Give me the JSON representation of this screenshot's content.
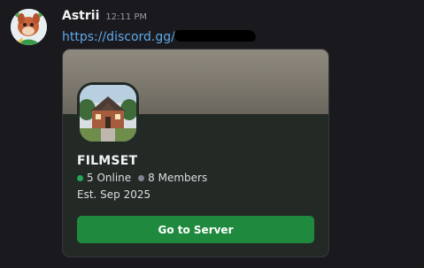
{
  "message": {
    "author": "Astrii",
    "timestamp": "12:11 PM",
    "link_text": "https://discord.gg/"
  },
  "invite": {
    "server_name": "FILMSET",
    "online_text": "5 Online",
    "members_text": "8 Members",
    "established": "Est. Sep 2025",
    "button_label": "Go to Server",
    "colors": {
      "online": "#23a55a",
      "members": "#80848e",
      "button": "#1f8a3e",
      "link": "#5fa8e8"
    }
  }
}
